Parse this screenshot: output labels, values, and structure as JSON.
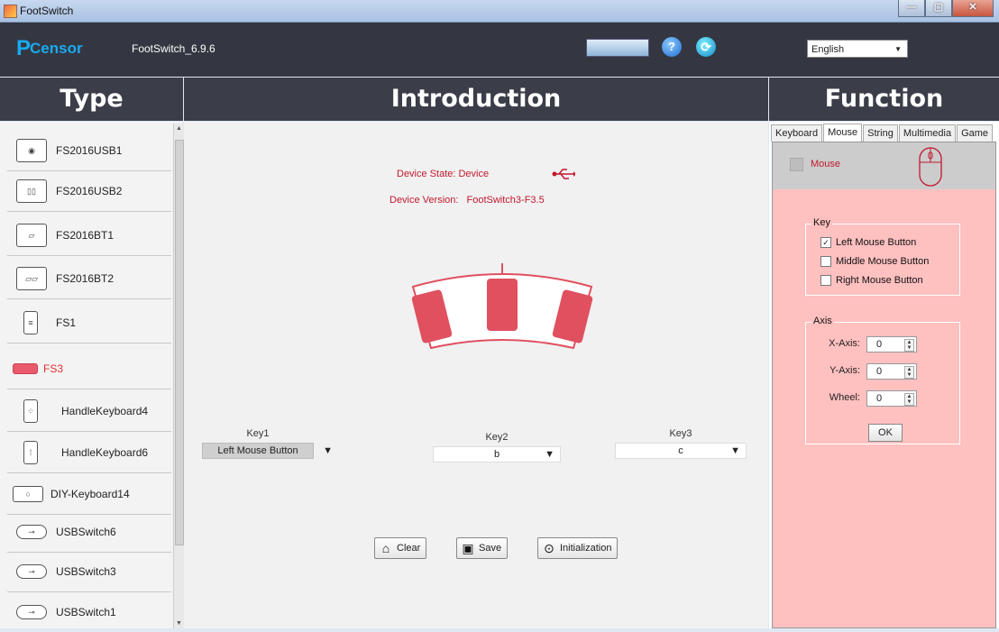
{
  "window": {
    "title": "FootSwitch"
  },
  "header": {
    "logo_p": "P",
    "logo_rest": "Censor",
    "app_version": "FootSwitch_6.9.6",
    "language": "English"
  },
  "columns": {
    "type": "Type",
    "introduction": "Introduction",
    "function": "Function"
  },
  "sidebar": {
    "items": [
      {
        "label": "FS2016USB1",
        "icon": "usb-pedal-icon"
      },
      {
        "label": "FS2016USB2",
        "icon": "double-pedal-icon"
      },
      {
        "label": "FS2016BT1",
        "icon": "bt-pedal-icon"
      },
      {
        "label": "FS2016BT2",
        "icon": "double-bt-pedal-icon"
      },
      {
        "label": "FS1",
        "icon": "single-pedal-icon"
      },
      {
        "label": "FS3",
        "icon": "triple-pedal-icon",
        "active": true
      },
      {
        "label": "HandleKeyboard4",
        "icon": "handle-keyboard-icon"
      },
      {
        "label": "HandleKeyboard6",
        "icon": "handle-keyboard-icon"
      },
      {
        "label": "DIY-Keyboard14",
        "icon": "diy-keyboard-icon"
      },
      {
        "label": "USBSwitch6",
        "icon": "usb-switch-icon"
      },
      {
        "label": "USBSwitch3",
        "icon": "usb-switch-icon"
      },
      {
        "label": "USBSwitch1",
        "icon": "usb-switch-icon"
      }
    ]
  },
  "device": {
    "state_label": "Device State:",
    "state_value": "Device",
    "version_label": "Device Version:",
    "version_value": "FootSwitch3-F3.5"
  },
  "keys": [
    {
      "label": "Key1",
      "value": "Left Mouse Button"
    },
    {
      "label": "Key2",
      "value": "b"
    },
    {
      "label": "Key3",
      "value": "c"
    }
  ],
  "actions": {
    "clear": "Clear",
    "save": "Save",
    "initialization": "Initialization"
  },
  "function_tabs": [
    "Keyboard",
    "Mouse",
    "String",
    "Multimedia",
    "Game"
  ],
  "active_tab": "Mouse",
  "mouse": {
    "label": "Mouse",
    "key_group": "Key",
    "buttons": [
      {
        "label": "Left Mouse Button",
        "checked": true
      },
      {
        "label": "Middle Mouse Button",
        "checked": false
      },
      {
        "label": "Right Mouse Button",
        "checked": false
      }
    ],
    "axis_group": "Axis",
    "axis": [
      {
        "label": "X-Axis:",
        "value": "0"
      },
      {
        "label": "Y-Axis:",
        "value": "0"
      },
      {
        "label": "Wheel:",
        "value": "0"
      }
    ],
    "ok": "OK"
  },
  "colors": {
    "accent_red": "#c0192e",
    "pedal_red": "#e0505f",
    "header_dark": "#343741",
    "function_bg": "#ffc0c0"
  }
}
